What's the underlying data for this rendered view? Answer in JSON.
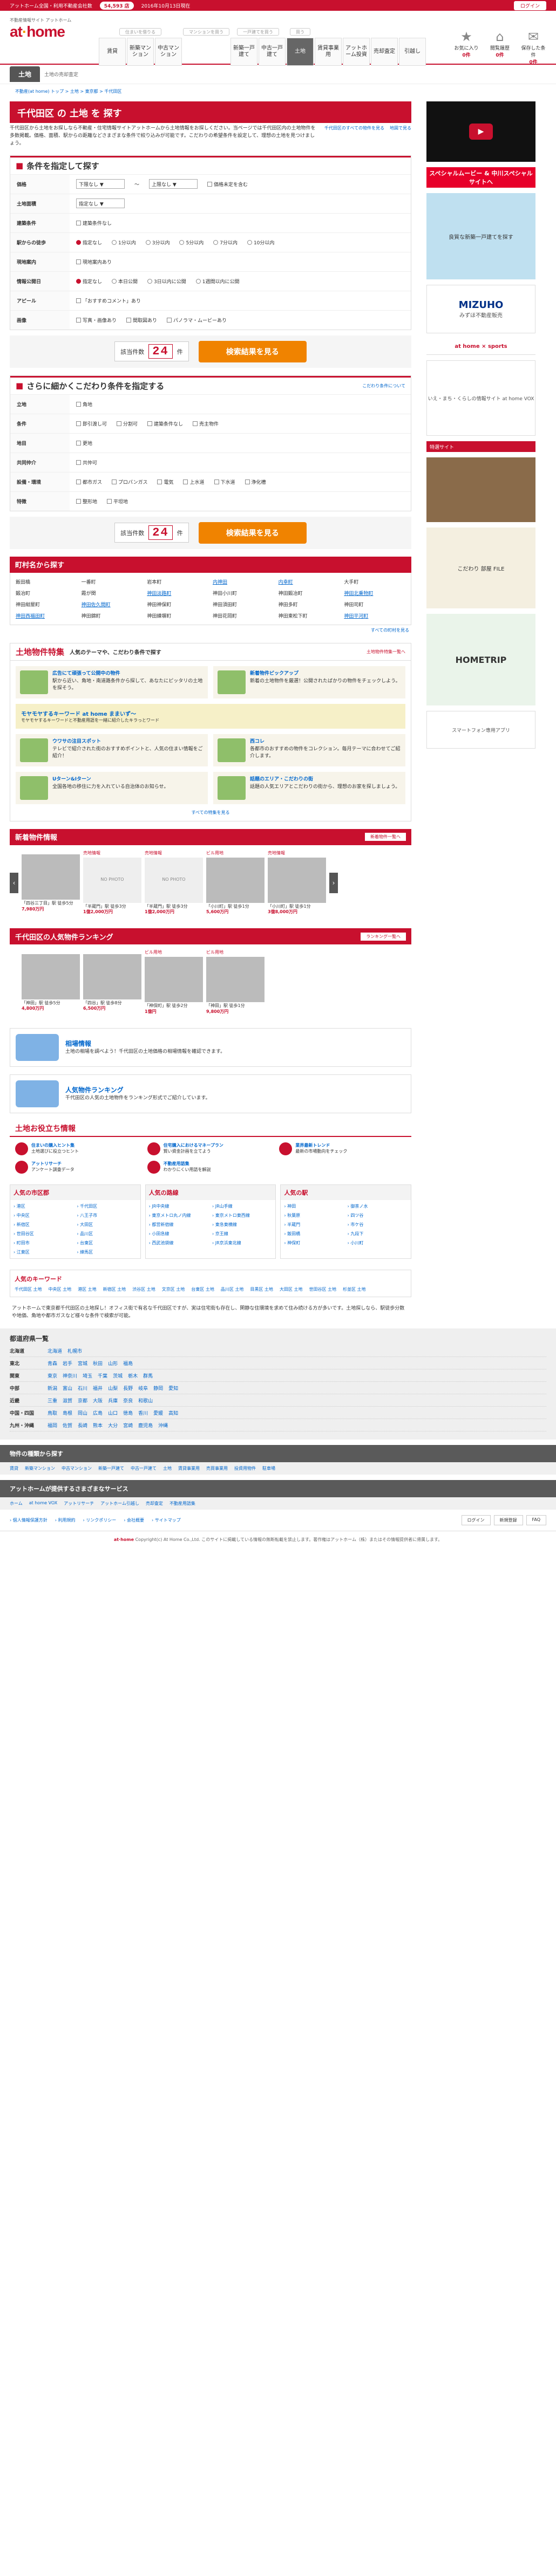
{
  "topbar": {
    "left": "アットホーム全国・利用不動産会社数",
    "count": "54,593 店",
    "date": "2016年10月13日現在",
    "login": "ログイン"
  },
  "header": {
    "tagline": "不動産情報サイト アットホーム",
    "logo_a": "at",
    "logo_b": "home",
    "cats": [
      {
        "head": "住まいを借りる",
        "items": [
          "賃貸",
          "新築マンション",
          "中古マンション"
        ]
      },
      {
        "head": "マンションを買う",
        "items": []
      },
      {
        "head": "一戸建てを買う",
        "items": [
          "新築一戸建て",
          "中古一戸建て"
        ]
      },
      {
        "head": "買う",
        "items": [
          "土地"
        ]
      },
      {
        "head": "",
        "items": [
          "賃貸事業用",
          "アットホーム投資",
          "売却査定",
          "引越し"
        ]
      }
    ],
    "icons": [
      {
        "glyph": "★",
        "label": "お気に入り",
        "count": "0件"
      },
      {
        "glyph": "⌂",
        "label": "閲覧履歴",
        "count": "0件"
      },
      {
        "glyph": "✉",
        "label": "保存した条件",
        "count": "0件"
      }
    ]
  },
  "tabbar": {
    "label": "土地",
    "sub": "土地の売却査定"
  },
  "crumb": "不動産(at home) トップ > 土地 > 東京都 > 千代田区",
  "title": "千代田区 の 土地 を 探す",
  "intro": "千代田区から土地をお探しなら不動産・住宅情報サイトアットホームから土地情報をお探しください。当ページでは千代田区内の土地物件を多数掲載。価格、面積、駅からの距離などさまざまな条件で絞り込みが可能です。こだわりの希望条件を設定して、理想の土地を見つけましょう。",
  "intro_links": [
    "千代田区のすべての物件を見る",
    "地図で見る"
  ],
  "cond": {
    "title": "条件を指定して探す",
    "rows": [
      {
        "k": "価格",
        "v": [
          "下限なし",
          "〜",
          "上限なし"
        ],
        "extra": "価格未定を含む"
      },
      {
        "k": "土地面積",
        "v": [
          "指定なし"
        ]
      },
      {
        "k": "建築条件",
        "v": [
          "建築条件なし"
        ]
      },
      {
        "k": "駅からの徒歩",
        "v": [
          "指定なし",
          "1分以内",
          "3分以内",
          "5分以内",
          "7分以内",
          "10分以内"
        ]
      },
      {
        "k": "現地案内",
        "v": [
          "現地案内あり"
        ]
      },
      {
        "k": "情報公開日",
        "v": [
          "指定なし",
          "本日公開",
          "3日以内に公開",
          "1週間以内に公開"
        ]
      },
      {
        "k": "アピール",
        "v": [
          "「おすすめコメント」あり"
        ]
      },
      {
        "k": "画像",
        "v": [
          "写真・画像あり",
          "間取図あり",
          "パノラマ・ムービーあり"
        ]
      }
    ]
  },
  "count": {
    "label": "該当件数",
    "num": "24",
    "unit": "件",
    "button": "検索結果を見る"
  },
  "detail": {
    "title": "さらに細かくこだわり条件を指定する",
    "link": "こだわり条件について",
    "rows": [
      {
        "k": "立地",
        "v": [
          "角地"
        ]
      },
      {
        "k": "条件",
        "v": [
          "即引渡し可",
          "分割可",
          "建築条件なし",
          "売主物件"
        ]
      },
      {
        "k": "地目",
        "v": [
          "更地"
        ]
      },
      {
        "k": "共同仲介",
        "v": [
          "共仲可"
        ]
      },
      {
        "k": "設備・環境",
        "v": [
          "都市ガス",
          "プロパンガス",
          "電気",
          "上水道",
          "下水道",
          "浄化槽"
        ]
      },
      {
        "k": "特徴",
        "v": [
          "整形地",
          "平坦地"
        ]
      }
    ]
  },
  "stations": {
    "title": "町村名から探す",
    "more": "すべての町村を見る",
    "items": [
      "飯田橋",
      "一番町",
      "岩本町",
      "内神田",
      "内幸町",
      "大手町",
      "鍛冶町",
      "霞が関",
      "神田淡路町",
      "神田小川町",
      "神田鍛冶町",
      "神田北乗物町",
      "神田紺屋町",
      "神田佐久間町",
      "神田神保町",
      "神田須田町",
      "神田多町",
      "神田司町",
      "神田西福田町",
      "神田錦町",
      "神田練塀町",
      "神田花岡町",
      "神田東松下町",
      "神田平河町"
    ]
  },
  "feature": {
    "title": "土地物件特集",
    "sub": "人気のテーマや、こだわり条件で探す",
    "go": "土地物件特集一覧へ",
    "cards": [
      {
        "t": "広告にて頑張って公開中の物件",
        "d": "駅から近い、角地・南道路条件から探して、あなたにピッタリの土地を探そう。"
      },
      {
        "t": "新着物件ピックアップ",
        "d": "新着の土地物件を厳選！公開されたばかりの物件をチェックしよう。"
      }
    ],
    "movie": {
      "t": "モヤモヤするキーワード at home ままいず〜",
      "d": "モヤモヤするキーワードと不動産用語を一緒に紹介したキラっとワード"
    },
    "cards2": [
      {
        "t": "ウワサの注目スポット",
        "d": "テレビで紹介された街のおすすめポイントと、人気の住まい情報をご紹介！"
      },
      {
        "t": "西コレ",
        "d": "各都市のおすすめの物件をコレクション。毎月テーマに合わせてご紹介します。"
      },
      {
        "t": "Uターン&Iターン",
        "d": "全国各地の移住に力を入れている自治体のお知らせ。"
      },
      {
        "t": "話題のエリア・こだわりの街",
        "d": "話題の人気エリアとこだわりの街から、理想のお家を探しましょう。"
      }
    ],
    "more": "すべての特集を見る"
  },
  "newprops": {
    "title": "新着物件情報",
    "more": "新着物件一覧へ",
    "items": [
      {
        "lbl": "",
        "name": "「四谷三丁目」駅 徒歩5分",
        "price": "7,980万円",
        "img": ""
      },
      {
        "lbl": "売地情報",
        "name": "「半蔵門」駅 徒歩3分",
        "price": "1億2,000万円",
        "img": "NO PHOTO"
      },
      {
        "lbl": "売地情報",
        "name": "「半蔵門」駅 徒歩3分",
        "price": "1億2,000万円",
        "img": "NO PHOTO"
      },
      {
        "lbl": "ビル用地",
        "name": "「小川町」駅 徒歩1分",
        "price": "5,600万円",
        "img": ""
      },
      {
        "lbl": "売地情報",
        "name": "「小川町」駅 徒歩1分",
        "price": "3億8,000万円",
        "img": ""
      }
    ]
  },
  "ranking": {
    "title": "千代田区の人気物件ランキング",
    "more": "ランキング一覧へ",
    "items": [
      {
        "lbl": "",
        "name": "「神田」駅 徒歩5分",
        "price": "4,800万円"
      },
      {
        "lbl": "",
        "name": "「四谷」駅 徒歩8分",
        "price": "6,500万円"
      },
      {
        "lbl": "ビル用地",
        "name": "「神保町」駅 徒歩2分",
        "price": "1億円"
      },
      {
        "lbl": "ビル用地",
        "name": "「神田」駅 徒歩1分",
        "price": "9,800万円"
      }
    ]
  },
  "banners": [
    {
      "t": "相場情報",
      "d": "土地の相場を調べよう！千代田区の土地価格の相場情報を確認できます。"
    },
    {
      "t": "人気物件ランキング",
      "d": "千代田区の人気の土地物件をランキング形式でご紹介しています。"
    }
  ],
  "tips": {
    "title": "土地お役立ち情報",
    "items": [
      {
        "t": "住まいの購入ヒント集",
        "d": "土地選びに役立つヒント"
      },
      {
        "t": "住宅購入におけるマネープラン",
        "d": "賢い資金計画を立てよう"
      },
      {
        "t": "業界最新トレンド",
        "d": "最新の市場動向をチェック"
      },
      {
        "t": "アットリサーチ",
        "d": "アンケート調査データ"
      },
      {
        "t": "不動産用語集",
        "d": "わかりにくい用語を解説"
      }
    ]
  },
  "popular": [
    {
      "h": "人気の市区郡",
      "items": [
        "港区",
        "千代田区",
        "中央区",
        "八王子市",
        "新宿区",
        "大田区",
        "世田谷区",
        "品川区",
        "町田市",
        "台東区",
        "江東区",
        "練馬区"
      ]
    },
    {
      "h": "人気の路線",
      "items": [
        "JR中央線",
        "JR山手線",
        "東京メトロ丸ノ内線",
        "東京メトロ東西線",
        "都営新宿線",
        "東急東横線",
        "小田急線",
        "京王線",
        "西武池袋線",
        "JR京浜東北線"
      ]
    },
    {
      "h": "人気の駅",
      "items": [
        "神田",
        "御茶ノ水",
        "秋葉原",
        "四ツ谷",
        "半蔵門",
        "市ケ谷",
        "飯田橋",
        "九段下",
        "神保町",
        "小川町"
      ]
    }
  ],
  "keywords": {
    "h": "人気のキーワード",
    "items": [
      "千代田区 土地",
      "中央区 土地",
      "港区 土地",
      "新宿区 土地",
      "渋谷区 土地",
      "文京区 土地",
      "台東区 土地",
      "品川区 土地",
      "目黒区 土地",
      "大田区 土地",
      "世田谷区 土地",
      "杉並区 土地"
    ]
  },
  "blurb": "アットホームで東京都千代田区の土地探し！オフィス街で有名な千代田区ですが、実は住宅街も存在し、閑静な住環境を求めて住み続ける方が多いです。土地探しなら、駅徒歩分数や地価、角地や都市ガスなど様々な条件で検索が可能。",
  "region": {
    "title": "都道府県一覧",
    "rows": [
      {
        "k": "北海道",
        "v": [
          "北海道",
          "札幌市"
        ]
      },
      {
        "k": "東北",
        "v": [
          "青森",
          "岩手",
          "宮城",
          "秋田",
          "山形",
          "福島"
        ]
      },
      {
        "k": "関東",
        "v": [
          "東京",
          "神奈川",
          "埼玉",
          "千葉",
          "茨城",
          "栃木",
          "群馬"
        ]
      },
      {
        "k": "中部",
        "v": [
          "新潟",
          "富山",
          "石川",
          "福井",
          "山梨",
          "長野",
          "岐阜",
          "静岡",
          "愛知"
        ]
      },
      {
        "k": "近畿",
        "v": [
          "三重",
          "滋賀",
          "京都",
          "大阪",
          "兵庫",
          "奈良",
          "和歌山"
        ]
      },
      {
        "k": "中国・四国",
        "v": [
          "鳥取",
          "島根",
          "岡山",
          "広島",
          "山口",
          "徳島",
          "香川",
          "愛媛",
          "高知"
        ]
      },
      {
        "k": "九州・沖縄",
        "v": [
          "福岡",
          "佐賀",
          "長崎",
          "熊本",
          "大分",
          "宮崎",
          "鹿児島",
          "沖縄"
        ]
      }
    ]
  },
  "cats2": {
    "title": "物件の種類から探す",
    "items": [
      "賃貸",
      "新築マンション",
      "中古マンション",
      "新築一戸建て",
      "中古一戸建て",
      "土地",
      "賃貸事業用",
      "売買事業用",
      "投資用物件",
      "駐車場"
    ]
  },
  "services": {
    "title": "アットホームが提供するさまざまなサービス",
    "items": [
      "ホーム",
      "at home VOX",
      "アットリサーチ",
      "アットホーム引越し",
      "売却査定",
      "不動産用語集"
    ]
  },
  "footer": {
    "links": [
      "個人情報保護方針",
      "利用規約",
      "リンクポリシー",
      "会社概要",
      "サイトマップ"
    ],
    "btns": [
      "ログイン",
      "新規登録",
      "FAQ"
    ],
    "copy": "Copyright(c) At Home Co.,Ltd. このサイトに掲載している情報の無断転載を禁止します。著作権はアットホーム（株）またはその情報提供者に帰属します。"
  },
  "side": {
    "video_label": "スペシャルムービー & 中川スペシャルサイトへ",
    "house": "良質な新築一戸建てを探す",
    "mizuho": "MIZUHO",
    "mizuho_sub": "みずほ不動産販売",
    "sports": "at home × sports",
    "vox": "いえ・まち・くらしの情報サイト at home VOX",
    "pickup": "特選サイト",
    "kodawari": "こだわり 部屋 FILE",
    "trip": "HOMETRIP",
    "phone": "スマートフォン専用アプリ"
  }
}
